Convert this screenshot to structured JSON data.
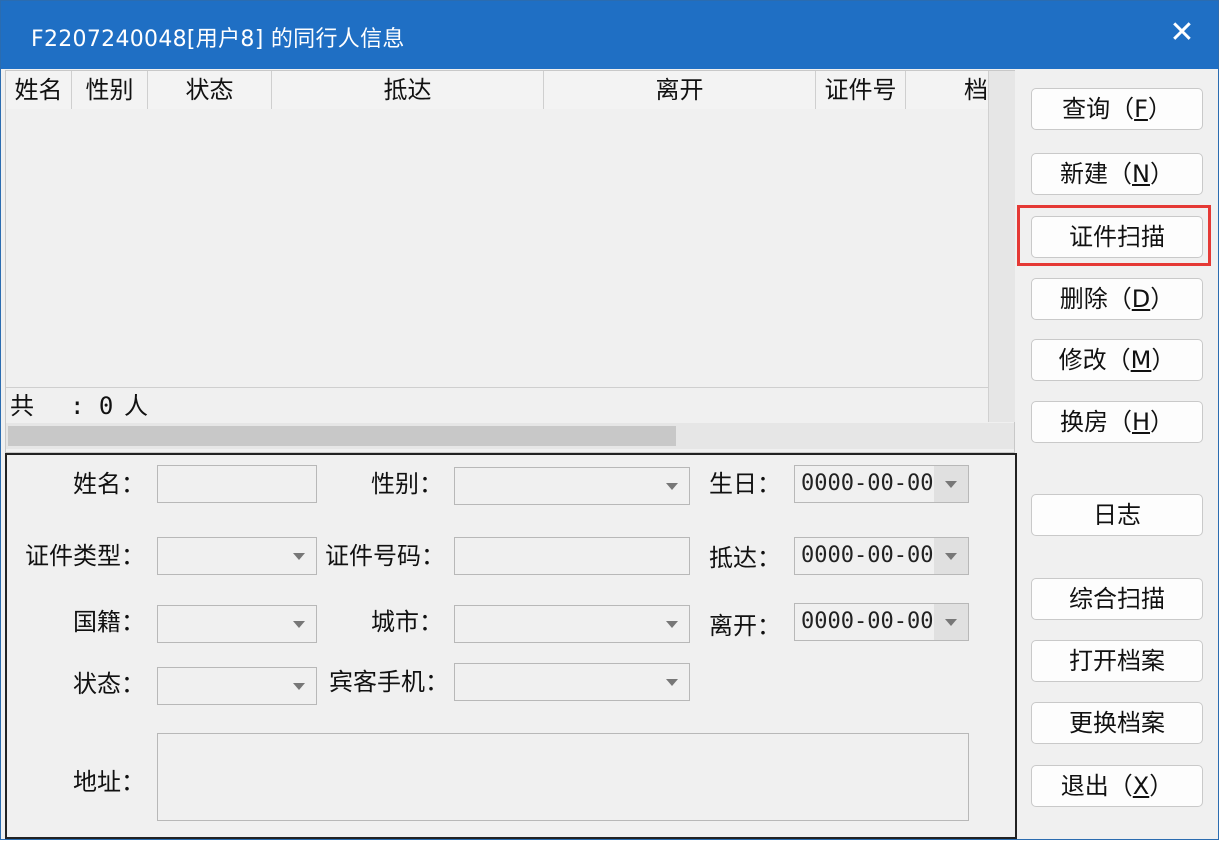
{
  "window": {
    "title": "F2207240048[用户8] 的同行人信息",
    "close_glyph": "✕"
  },
  "grid": {
    "columns": [
      "姓名",
      "性别",
      "状态",
      "抵达",
      "离开",
      "证件号",
      "档"
    ],
    "footer_label": "共",
    "footer_count": ": 0",
    "footer_unit": "人"
  },
  "form": {
    "name_label": "姓名：",
    "gender_label": "性别：",
    "birthday_label": "生日：",
    "birthday_value": "0000-00-00",
    "id_type_label": "证件类型：",
    "id_number_label": "证件号码：",
    "arrive_label": "抵达：",
    "arrive_value": "0000-00-00",
    "nationality_label": "国籍：",
    "city_label": "城市：",
    "leave_label": "离开：",
    "leave_value": "0000-00-00",
    "status_label": "状态：",
    "mobile_label": "宾客手机：",
    "address_label": "地址："
  },
  "buttons": {
    "query": {
      "text": "查询（",
      "key": "F",
      "end": "）"
    },
    "new": {
      "text": "新建（",
      "key": "N",
      "end": "）"
    },
    "scan_id": "证件扫描",
    "delete": {
      "text": "删除（",
      "key": "D",
      "end": "）"
    },
    "modify": {
      "text": "修改（",
      "key": "M",
      "end": "）"
    },
    "change_room": {
      "text": "换房（",
      "key": "H",
      "end": "）"
    },
    "log": "日志",
    "combined_scan": "综合扫描",
    "open_archive": "打开档案",
    "replace_archive": "更换档案",
    "exit": {
      "text": "退出（",
      "key": "X",
      "end": "）"
    }
  },
  "colors": {
    "titlebar": "#1f6fc4",
    "highlight": "#e53935"
  }
}
